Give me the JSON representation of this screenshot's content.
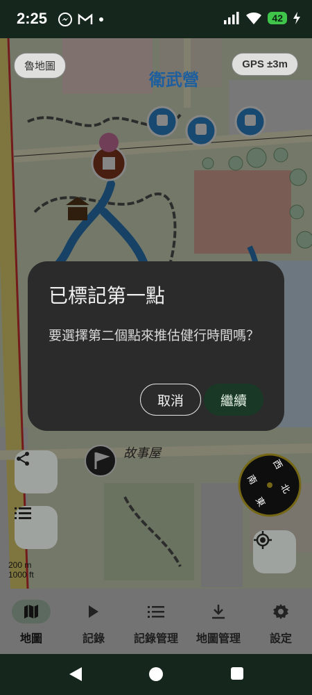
{
  "status_bar": {
    "time": "2:25",
    "battery": "42",
    "icons": [
      "messenger-icon",
      "gmail-icon",
      "dot-icon",
      "signal-icon",
      "wifi-icon",
      "battery-icon",
      "charging-icon"
    ]
  },
  "map": {
    "map_name_chip": "魯地圖",
    "gps_chip": "GPS ±3m",
    "district_label": "衛武營",
    "park_label_left": "衛武營",
    "story_house_label": "故事屋",
    "scale_metric": "200 m",
    "scale_imperial": "1000 ft",
    "compass": {
      "n": "北",
      "s": "南",
      "e": "東",
      "w": "西"
    }
  },
  "dialog": {
    "title": "已標記第一點",
    "message": "要選擇第二個點來推估健行時間嗎？",
    "cancel_label": "取消",
    "continue_label": "繼續"
  },
  "bottom_nav": {
    "items": [
      {
        "label": "地圖",
        "icon": "map-icon",
        "active": true
      },
      {
        "label": "記錄",
        "icon": "play-icon",
        "active": false
      },
      {
        "label": "記錄管理",
        "icon": "list-icon",
        "active": false
      },
      {
        "label": "地圖管理",
        "icon": "download-icon",
        "active": false
      },
      {
        "label": "設定",
        "icon": "gear-icon",
        "active": false
      }
    ]
  },
  "colors": {
    "status_bg": "#15261c",
    "dialog_bg": "#2a2b2a",
    "continue_bg": "#193826",
    "battery": "#3fc54a",
    "transit_icon": "#2f8fd8"
  }
}
